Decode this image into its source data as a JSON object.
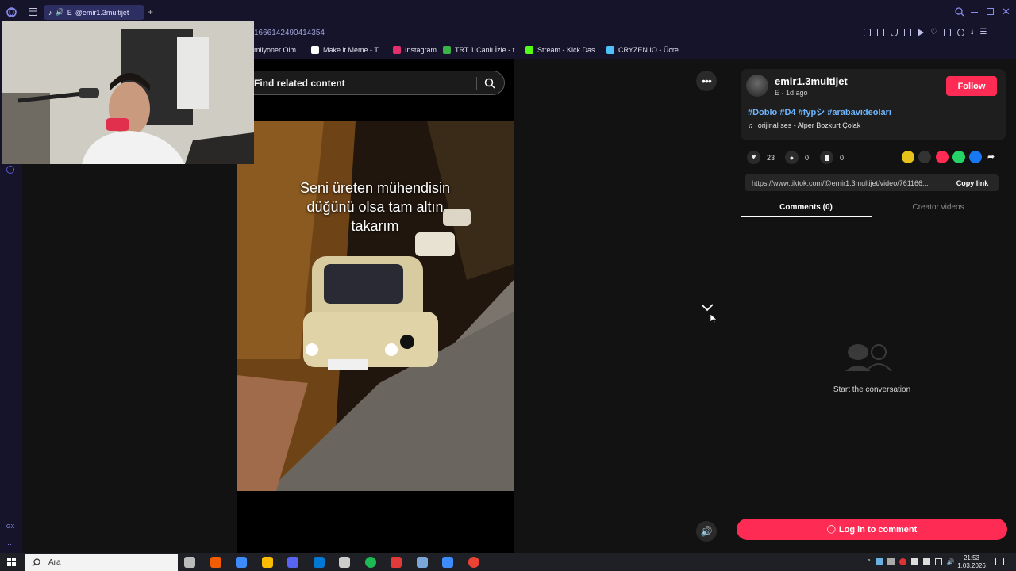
{
  "browser": {
    "tab_title": "@emir1.3multijet",
    "tab_prefix": "E",
    "url_partial": "1666142490414354",
    "bookmarks": [
      {
        "label": "milyoner Olm...",
        "color": "#d4b10a"
      },
      {
        "label": "Make it Meme - T...",
        "color": "#ffffff"
      },
      {
        "label": "Instagram",
        "color": "#e1306c"
      },
      {
        "label": "TRT 1 Canlı İzle - t...",
        "color": "#3bb34a"
      },
      {
        "label": "Stream - Kick Das...",
        "color": "#53fc18"
      },
      {
        "label": "CRYZEN.IO - Ücre...",
        "color": "#4fc3f7"
      }
    ]
  },
  "search": {
    "placeholder": "Find related content"
  },
  "video": {
    "caption_lines": [
      "Seni üreten mühendisin",
      "düğünü olsa tam altın",
      "takarım"
    ]
  },
  "author": {
    "username": "emir1.3multijet",
    "subtitle": "E · 1d ago",
    "follow_label": "Follow"
  },
  "post": {
    "hashtags": "#Doblo #D4 #fypシ #arabavideoları",
    "music": "orijinal ses - Alper Bozkurt Çolak"
  },
  "stats": {
    "likes": "23",
    "comments": "0",
    "saves": "0"
  },
  "share_colors": [
    "#e7c21b",
    "#333333",
    "#fe2c55",
    "#25d366",
    "#1877f2"
  ],
  "link": {
    "url": "https://www.tiktok.com/@emir1.3multijet/video/761166...",
    "copy_label": "Copy link"
  },
  "tabs": {
    "comments": "Comments (0)",
    "creator": "Creator videos"
  },
  "empty_state": "Start the conversation",
  "login_label": "Log in to comment",
  "taskbar": {
    "search_label": "Ara",
    "time": "21:53",
    "date": "1.03.2026",
    "app_colors": [
      "#bbbbbb",
      "#f25c05",
      "#3d8bfd",
      "#fbbc04",
      "#5865f2",
      "#0078d4",
      "#cccccc",
      "#1db954",
      "#e03a3a",
      "#7aa7d8",
      "#3d8bfd",
      "#ea4335"
    ]
  }
}
